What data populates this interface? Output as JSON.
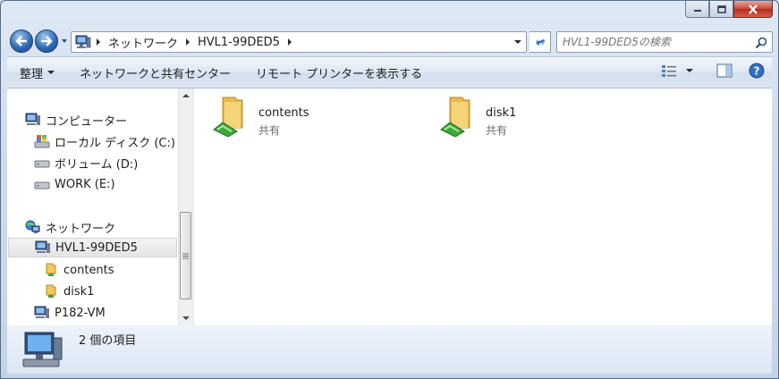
{
  "breadcrumb": [
    "ネットワーク",
    "HVL1-99DED5"
  ],
  "search": {
    "placeholder": "HVL1-99DED5の検索"
  },
  "toolbar": {
    "organize": "整理",
    "network_center": "ネットワークと共有センター",
    "remote_printers": "リモート プリンターを表示する"
  },
  "nav_pane": {
    "computer": "コンピューター",
    "local_disk": "ローカル ディスク (C:)",
    "volume_d": "ボリューム (D:)",
    "work_e": "WORK (E:)",
    "network": "ネットワーク",
    "host": "HVL1-99DED5",
    "share_contents": "contents",
    "share_disk1": "disk1",
    "p182": "P182-VM"
  },
  "files": [
    {
      "name": "contents",
      "type": "共有"
    },
    {
      "name": "disk1",
      "type": "共有"
    }
  ],
  "details": {
    "count_text": "2 個の項目"
  },
  "colors": {
    "folder": "#f2c75c",
    "accent": "#2a66b4",
    "share_green": "#3aa83a"
  }
}
